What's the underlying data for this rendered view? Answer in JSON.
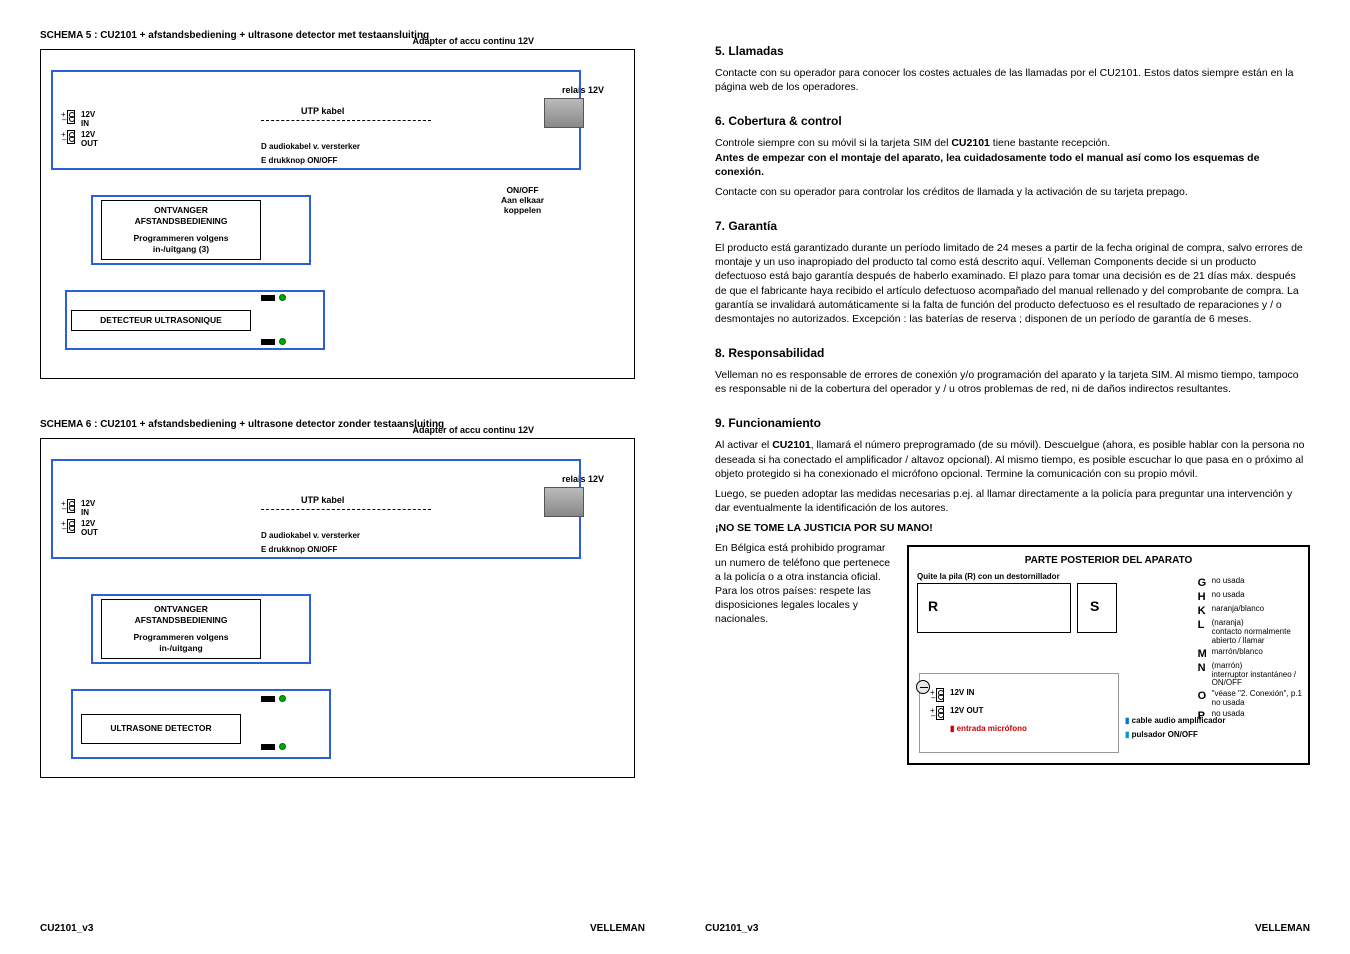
{
  "left": {
    "schema5_title": "SCHEMA 5 : CU2101 + afstandsbediening + ultrasone detector met testaansluiting",
    "schema6_title": "SCHEMA 6 : CU2101 + afstandsbediening + ultrasone detector zonder testaansluiting",
    "adapter_label": "Adapter of accu continu 12V",
    "relais_label": "relais 12V",
    "utp_label": "UTP kabel",
    "audio_label_d": "D audiokabel v. versterker",
    "audio_label_e": "E drukknop ON/OFF",
    "onoff_label": "ON/OFF\nAan elkaar\nkoppelen",
    "v12in": "12V IN",
    "v12out": "12V OUT",
    "ontvanger_box": "ONTVANGER\nAFSTANDSBEDIENING",
    "prog_lines_5": "Programmeren volgens\nin-/uitgang (3)",
    "prog_lines_6": "Programmeren volgens\nin-/uitgang",
    "detector5": "DETECTEUR ULTRASONIQUE",
    "detector6": "ULTRASONE DETECTOR",
    "footer_left": "CU2101_v3",
    "footer_right": "VELLEMAN"
  },
  "right": {
    "s5_h": "5.  Llamadas",
    "s5_p": "Contacte con su operador para conocer los costes actuales de las llamadas por el CU2101. Estos datos siempre están en la página web de los operadores.",
    "s6_h": "6.  Cobertura & control",
    "s6_p1a": "Controle siempre con su móvil si la tarjeta SIM del ",
    "s6_p1b": "CU2101",
    "s6_p1c": " tiene bastante recepción.",
    "s6_p2": "Antes de empezar con el montaje del aparato, lea cuidadosamente todo el manual así como los esquemas de conexión.",
    "s6_p3": "Contacte con su operador para controlar los créditos de llamada y la activación de su tarjeta prepago.",
    "s7_h": "7.  Garantía",
    "s7_p": "El producto está garantizado durante un período limitado de 24 meses a partir de la fecha original de compra, salvo errores de montaje y un uso inapropiado del producto tal como está descrito aquí. Velleman Components decide si un producto defectuoso está bajo garantía después de haberlo examinado. El plazo para tomar una decisión es de 21 días máx. después de que el fabricante haya recibido el artículo defectuoso acompañado del manual rellenado y del comprobante de compra. La garantía se invalidará automáticamente si la falta de función del producto defectuoso es el resultado de reparaciones y / o desmontajes no autorizados. Excepción : las baterías de reserva ; disponen de un período de garantía de 6 meses.",
    "s8_h": "8.  Responsabilidad",
    "s8_p": "Velleman no es responsable de errores de conexión y/o programación del aparato y la tarjeta SIM. Al mismo tiempo, tampoco es responsable ni de la cobertura del operador y / u otros problemas de red, ni de daños indirectos resultantes.",
    "s9_h": "9.  Funcionamiento",
    "s9_p1a": "Al activar el ",
    "s9_p1b": "CU2101",
    "s9_p1c": ", llamará el número preprogramado (de su móvil). Descuelgue (ahora, es posible hablar con la persona no deseada si ha conectado el amplificador / altavoz opcional). Al mismo tiempo, es posible escuchar lo que pasa en o próximo al objeto protegido si ha conexionado el micrófono opcional. Termine la comunicación con su propio móvil.",
    "s9_p2": "Luego, se pueden adoptar las medidas necesarias p.ej. al llamar directamente a la policía para preguntar una intervención y dar eventualmente la identificación de los autores.",
    "s9_p3": "¡NO SE TOME LA JUSTICIA POR SU MANO!",
    "s9_side": "En Bélgica está prohibido programar un numero de teléfono que pertenece a la policía o a otra instancia oficial.\nPara los otros países: respete las disposiciones legales locales y nacionales.",
    "panel_title": "PARTE POSTERIOR DEL APARATO",
    "panel_sub": "Quite la pila (R) con un destornillador",
    "r_letter": "R",
    "s_letter": "S",
    "io_12vin": "12V IN",
    "io_12vout": "12V OUT",
    "io_mic": "entrada micrófono",
    "io_amp": "cable audio amplificador",
    "io_btn": "pulsador ON/OFF",
    "conn": {
      "G": "no usada",
      "H": "no usada",
      "K": "naranja/blanco",
      "L": "(naranja)\ncontacto normalmente\nabierto / llamar",
      "M": "marrón/blanco",
      "N": "(marrón)\ninterruptor instantáneo /\nON/OFF",
      "O": "\"véase \"2. Conexión\", p.1\nno usada",
      "P": "no usada"
    },
    "footer_left": "CU2101_v3",
    "footer_right": "VELLEMAN"
  }
}
